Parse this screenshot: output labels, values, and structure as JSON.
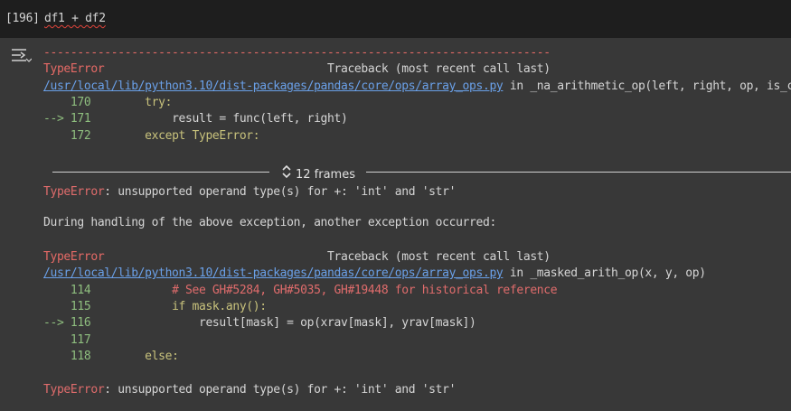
{
  "input": {
    "prompt": "[196]",
    "code": "df1 + df2"
  },
  "icons": {
    "collapse": "output-collapse-icon",
    "frames": "unfold-chevron-icon"
  },
  "colors": {
    "error": "#e06c6c",
    "link": "#6aa0e8",
    "arrow": "#8fbf7f",
    "keyword": "#c8c27c"
  },
  "tb1": {
    "dashes": "---------------------------------------------------------------------------",
    "error_name": "TypeError",
    "header": "                                 Traceback (most recent call last)",
    "path": "/usr/local/lib/python3.10/dist-packages/pandas/core/ops/array_ops.py",
    "in_func": " in _na_arithmetic_op(left, right, op, is_cmp)",
    "l1_no": "    170",
    "l1_code": "        try:",
    "l2_no": "--> 171",
    "l2_code": "            result = func(left, right)",
    "l3_no": "    172",
    "l3_code": "        except TypeError:"
  },
  "frames": {
    "label": "12 frames"
  },
  "err1": {
    "name": "TypeError",
    "message": ": unsupported operand type(s) for +: 'int' and 'str'"
  },
  "during": "During handling of the above exception, another exception occurred:",
  "tb2": {
    "error_name": "TypeError",
    "header": "                                 Traceback (most recent call last)",
    "path": "/usr/local/lib/python3.10/dist-packages/pandas/core/ops/array_ops.py",
    "in_func": " in _masked_arith_op(x, y, op)",
    "l1_no": "    114",
    "l1_code": "            # See GH#5284, GH#5035, GH#19448 for historical reference",
    "l2_no": "    115",
    "l2_code": "            if mask.any():",
    "l3_no": "--> 116",
    "l3_code": "                result[mask] = op(xrav[mask], yrav[mask])",
    "l4_no": "    117",
    "l5_no": "    118",
    "l5_code": "        else:"
  },
  "err2": {
    "name": "TypeError",
    "message": ": unsupported operand type(s) for +: 'int' and 'str'"
  }
}
